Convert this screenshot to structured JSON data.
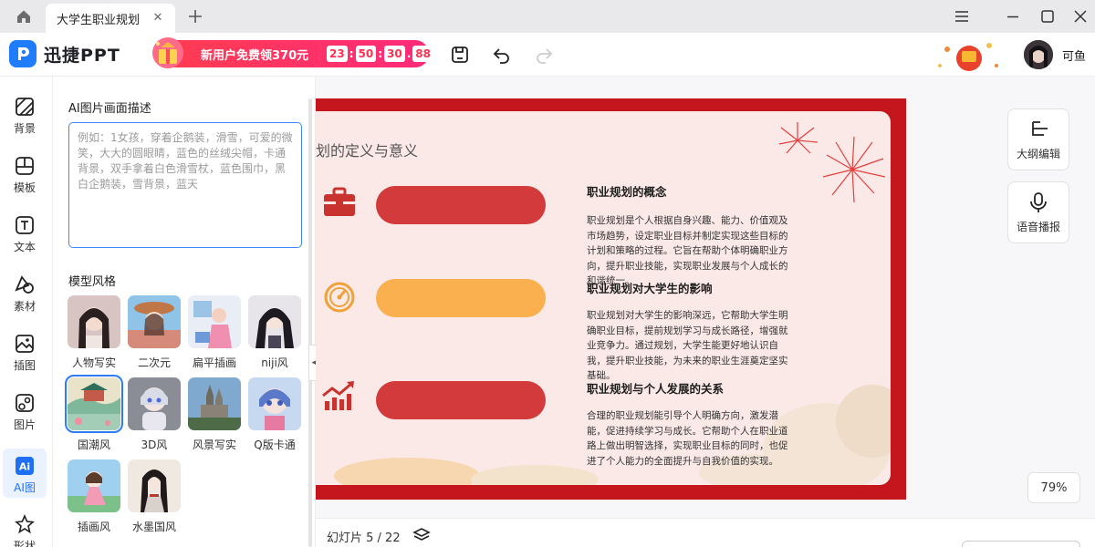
{
  "window": {
    "tab_title": "大学生职业规划",
    "icons": [
      "home-icon",
      "close-icon",
      "plus-icon",
      "menu-icon",
      "minimize-icon",
      "maximize-icon",
      "window-close-icon"
    ]
  },
  "toolbar": {
    "app_name": "迅捷PPT",
    "promo_text": "新用户免费领370元",
    "timer": [
      "23",
      "50",
      "30",
      "88"
    ],
    "username": "可鱼"
  },
  "rail": {
    "items": [
      {
        "label": "背景",
        "icon": "background-icon"
      },
      {
        "label": "模板",
        "icon": "template-icon"
      },
      {
        "label": "文本",
        "icon": "text-icon"
      },
      {
        "label": "素材",
        "icon": "material-icon"
      },
      {
        "label": "插图",
        "icon": "illustration-icon"
      },
      {
        "label": "图片",
        "icon": "image-icon"
      },
      {
        "label": "AI图",
        "icon": "ai-image-icon"
      },
      {
        "label": "形状",
        "icon": "shape-icon"
      }
    ],
    "active_index": 6
  },
  "panel": {
    "title": "AI图片画面描述",
    "placeholder": "例如：1女孩，穿着企鹅装，滑雪，可爱的微笑，大大的圆眼睛，蓝色的丝绒尖帽，卡通背景，双手拿着白色滑雪杖，蓝色围巾，黑白企鹅装，雪背景，蓝天",
    "style_title": "模型风格",
    "styles": [
      {
        "label": "人物写实"
      },
      {
        "label": "二次元"
      },
      {
        "label": "扁平插画"
      },
      {
        "label": "niji风"
      },
      {
        "label": "国潮风"
      },
      {
        "label": "3D风"
      },
      {
        "label": "风景写实"
      },
      {
        "label": "Q版卡通"
      },
      {
        "label": "插画风"
      },
      {
        "label": "水墨国风"
      }
    ],
    "selected_style": "国潮风"
  },
  "slide": {
    "title": "划的定义与意义",
    "sections": [
      {
        "heading": "职业规划的概念",
        "body": "职业规划是个人根据自身兴趣、能力、价值观及市场趋势，设定职业目标并制定实现这些目标的计划和策略的过程。它旨在帮助个体明确职业方向，提升职业技能，实现职业发展与个人成长的和谐统一。",
        "icon": "briefcase-icon",
        "color": "#d33a3b"
      },
      {
        "heading": "职业规划对大学生的影响",
        "body": "职业规划对大学生的影响深远，它帮助大学生明确职业目标，提前规划学习与成长路径，增强就业竞争力。通过规划，大学生能更好地认识自我，提升职业技能，为未来的职业生涯奠定坚实基础。",
        "icon": "speedometer-icon",
        "color": "#fbb04f"
      },
      {
        "heading": "职业规划与个人发展的关系",
        "body": "合理的职业规划能引导个人明确方向，激发潜能，促进持续学习与成长。它帮助个人在职业道路上做出明智选择，实现职业目标的同时，也促进了个人能力的全面提升与自我价值的实现。",
        "icon": "growth-chart-icon",
        "color": "#d33a3b"
      }
    ]
  },
  "side_buttons": [
    {
      "label": "大纲编辑",
      "icon": "outline-icon"
    },
    {
      "label": "语音播报",
      "icon": "microphone-icon"
    }
  ],
  "zoom": "79%",
  "bottom": {
    "slide_counter": "幻灯片 5 / 22"
  }
}
